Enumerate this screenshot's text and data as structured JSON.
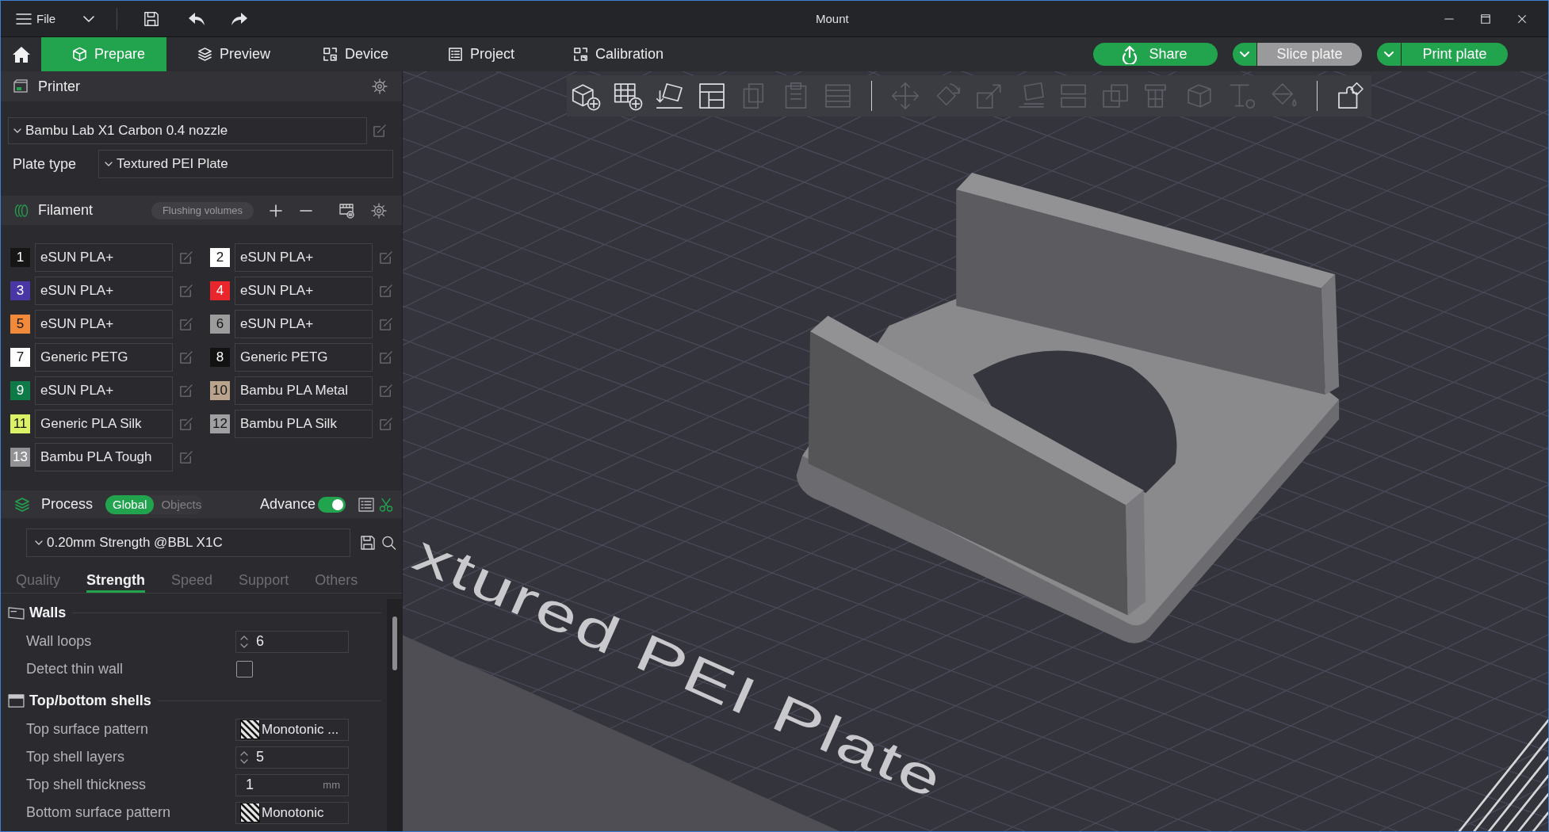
{
  "window": {
    "title": "Mount"
  },
  "title_bar": {
    "menu": "File"
  },
  "nav_tabs": [
    {
      "label": "Prepare",
      "selected": true
    },
    {
      "label": "Preview",
      "selected": false
    },
    {
      "label": "Device",
      "selected": false
    },
    {
      "label": "Project",
      "selected": false
    },
    {
      "label": "Calibration",
      "selected": false
    }
  ],
  "actions": [
    {
      "kind": "share",
      "label": "Share"
    },
    {
      "kind": "split",
      "label": "Slice plate",
      "disabled": true
    },
    {
      "kind": "split",
      "label": "Print plate",
      "disabled": false
    }
  ],
  "printer": {
    "title": "Printer",
    "preset": "Bambu Lab X1 Carbon 0.4 nozzle",
    "plate_type_label": "Plate type",
    "plate_type": "Textured PEI Plate"
  },
  "filament": {
    "title": "Filament",
    "flushing_button": "Flushing volumes",
    "slots": [
      {
        "number": "1",
        "name": "eSUN PLA+",
        "color": "#161616"
      },
      {
        "number": "2",
        "name": "eSUN PLA+",
        "color": "#ffffff"
      },
      {
        "number": "3",
        "name": "eSUN PLA+",
        "color": "#4a37a6"
      },
      {
        "number": "4",
        "name": "eSUN PLA+",
        "color": "#e8262b"
      },
      {
        "number": "5",
        "name": "eSUN PLA+",
        "color": "#f28a3c"
      },
      {
        "number": "6",
        "name": "eSUN PLA+",
        "color": "#9c9c9c"
      },
      {
        "number": "7",
        "name": "Generic PETG",
        "color": "#ffffff"
      },
      {
        "number": "8",
        "name": "Generic PETG",
        "color": "#121212"
      },
      {
        "number": "9",
        "name": "eSUN PLA+",
        "color": "#0e7a48"
      },
      {
        "number": "10",
        "name": "Bambu PLA Metal",
        "color": "#b9a38c"
      },
      {
        "number": "11",
        "name": "Generic PLA Silk",
        "color": "#dcf266"
      },
      {
        "number": "12",
        "name": "Bambu PLA Silk",
        "color": "#a0a0a2"
      },
      {
        "number": "13",
        "name": "Bambu PLA Tough",
        "color": "#929294"
      }
    ]
  },
  "process": {
    "title": "Process",
    "scope": [
      {
        "label": "Global",
        "selected": true
      },
      {
        "label": "Objects",
        "selected": false
      }
    ],
    "advance": {
      "label": "Advance",
      "on": true
    },
    "preset": "0.20mm Strength @BBL X1C",
    "tabs": [
      {
        "label": "Quality",
        "selected": false
      },
      {
        "label": "Strength",
        "selected": true
      },
      {
        "label": "Speed",
        "selected": false
      },
      {
        "label": "Support",
        "selected": false
      },
      {
        "label": "Others",
        "selected": false
      }
    ],
    "groups": [
      {
        "title": "Walls",
        "settings": [
          {
            "kind": "spin",
            "label": "Wall loops",
            "value": "6"
          },
          {
            "kind": "checkbox",
            "label": "Detect thin wall",
            "checked": false
          }
        ]
      },
      {
        "title": "Top/bottom shells",
        "settings": [
          {
            "kind": "pattern",
            "label": "Top surface pattern",
            "value": "Monotonic ..."
          },
          {
            "kind": "spin",
            "label": "Top shell layers",
            "value": "5"
          },
          {
            "kind": "unit",
            "label": "Top shell thickness",
            "value": "1",
            "unit": "mm"
          },
          {
            "kind": "pattern",
            "label": "Bottom surface pattern",
            "value": "Monotonic"
          }
        ]
      }
    ]
  },
  "viewport": {
    "toolbar": [
      [
        {
          "disabled": false
        },
        {
          "disabled": false
        },
        {
          "disabled": false
        },
        {
          "disabled": false
        },
        {
          "disabled": true
        },
        {
          "disabled": true
        },
        {
          "disabled": true
        }
      ],
      [
        {
          "disabled": true
        },
        {
          "disabled": true
        },
        {
          "disabled": true
        },
        {
          "disabled": true
        },
        {
          "disabled": true
        },
        {
          "disabled": true
        },
        {
          "disabled": true
        },
        {
          "disabled": true
        },
        {
          "disabled": true
        },
        {
          "disabled": true
        }
      ],
      [
        {
          "disabled": false
        }
      ]
    ],
    "plate_label": "xtured PEI Plate"
  }
}
